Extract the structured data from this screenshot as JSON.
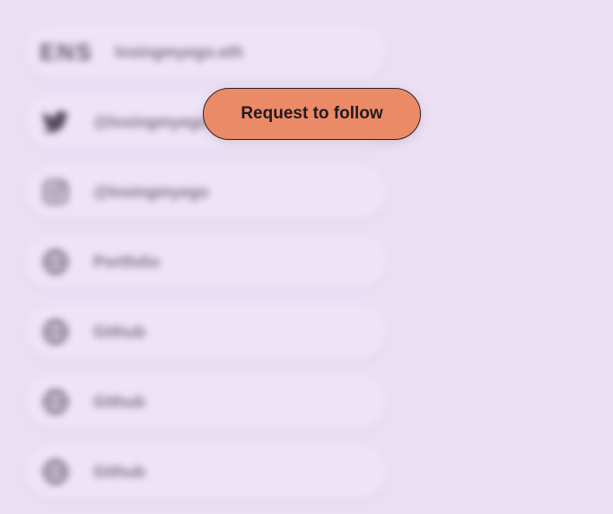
{
  "links": [
    {
      "type": "ens",
      "icon": "ens-logo-icon",
      "icon_text": "ENS",
      "label": "losingmyego.eth"
    },
    {
      "type": "twitter",
      "icon": "twitter-bird-icon",
      "label": "@losingmyego"
    },
    {
      "type": "instagram",
      "icon": "instagram-icon",
      "label": "@losingmyego"
    },
    {
      "type": "globe",
      "icon": "globe-icon",
      "label": "Portfolio"
    },
    {
      "type": "globe",
      "icon": "globe-icon",
      "label": "Github"
    },
    {
      "type": "globe",
      "icon": "globe-icon",
      "label": "Github"
    },
    {
      "type": "globe",
      "icon": "globe-icon",
      "label": "Github"
    }
  ],
  "follow_button": {
    "label": "Request to follow",
    "color": "#ea8a67"
  },
  "colors": {
    "background": "#ebdff4",
    "card": "#efe5f8"
  }
}
